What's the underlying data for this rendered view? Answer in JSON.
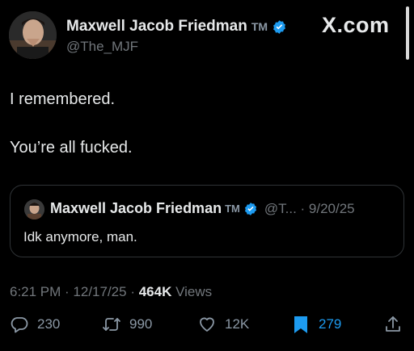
{
  "author": {
    "display_name": "Maxwell Jacob Friedman",
    "tm": "TM",
    "handle": "@The_MJF"
  },
  "brand": "X.com",
  "tweet": {
    "lines": [
      "I remembered.",
      "You’re all fucked."
    ]
  },
  "quote": {
    "display_name": "Maxwell Jacob Friedman",
    "tm": "TM",
    "meta": "@T... · 9/20/25",
    "text": "Idk anymore, man."
  },
  "timestamp": {
    "time_date": "6:21 PM · 12/17/25 · ",
    "views_count": "464K",
    "views_label": " Views"
  },
  "actions": {
    "replies": "230",
    "reposts": "990",
    "likes": "12K",
    "bookmarks": "279"
  },
  "icons": {
    "verified": "verified-badge-icon",
    "reply": "reply-icon",
    "repost": "repost-icon",
    "like": "heart-icon",
    "bookmark": "bookmark-icon",
    "share": "share-icon"
  },
  "colors": {
    "background": "#000000",
    "text": "#e7e9ea",
    "muted": "#71767b",
    "accent": "#1d9bf0"
  }
}
